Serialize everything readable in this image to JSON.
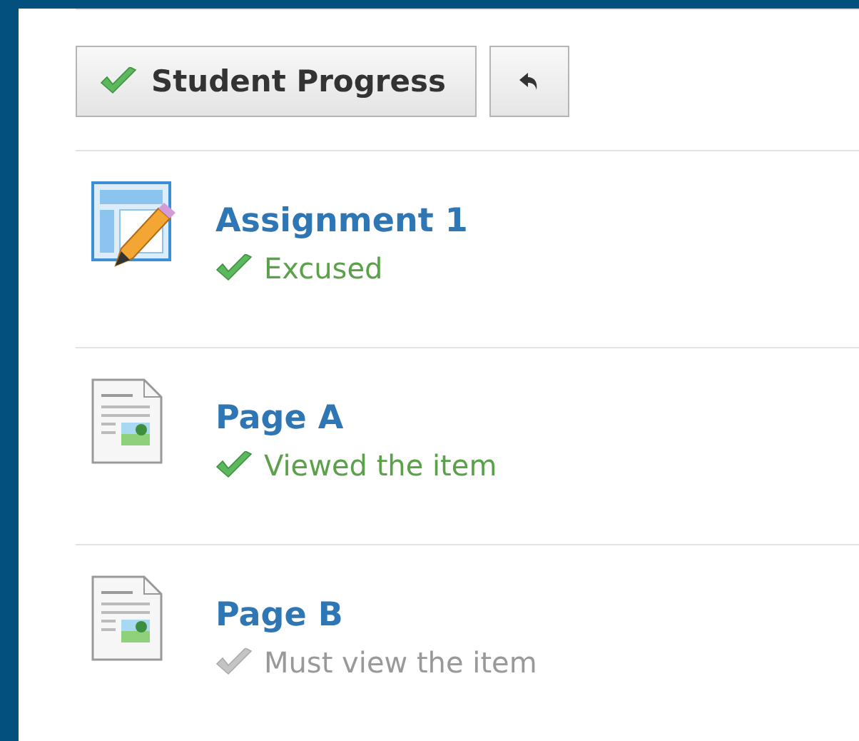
{
  "toolbar": {
    "progress_button": {
      "label": "Student Progress",
      "completed": true
    }
  },
  "items": [
    {
      "kind": "assignment",
      "title": "Assignment 1",
      "status": "Excused",
      "completed": true
    },
    {
      "kind": "page",
      "title": "Page A",
      "status": "Viewed the item",
      "completed": true
    },
    {
      "kind": "page",
      "title": "Page B",
      "status": "Must view the item",
      "completed": false
    }
  ]
}
